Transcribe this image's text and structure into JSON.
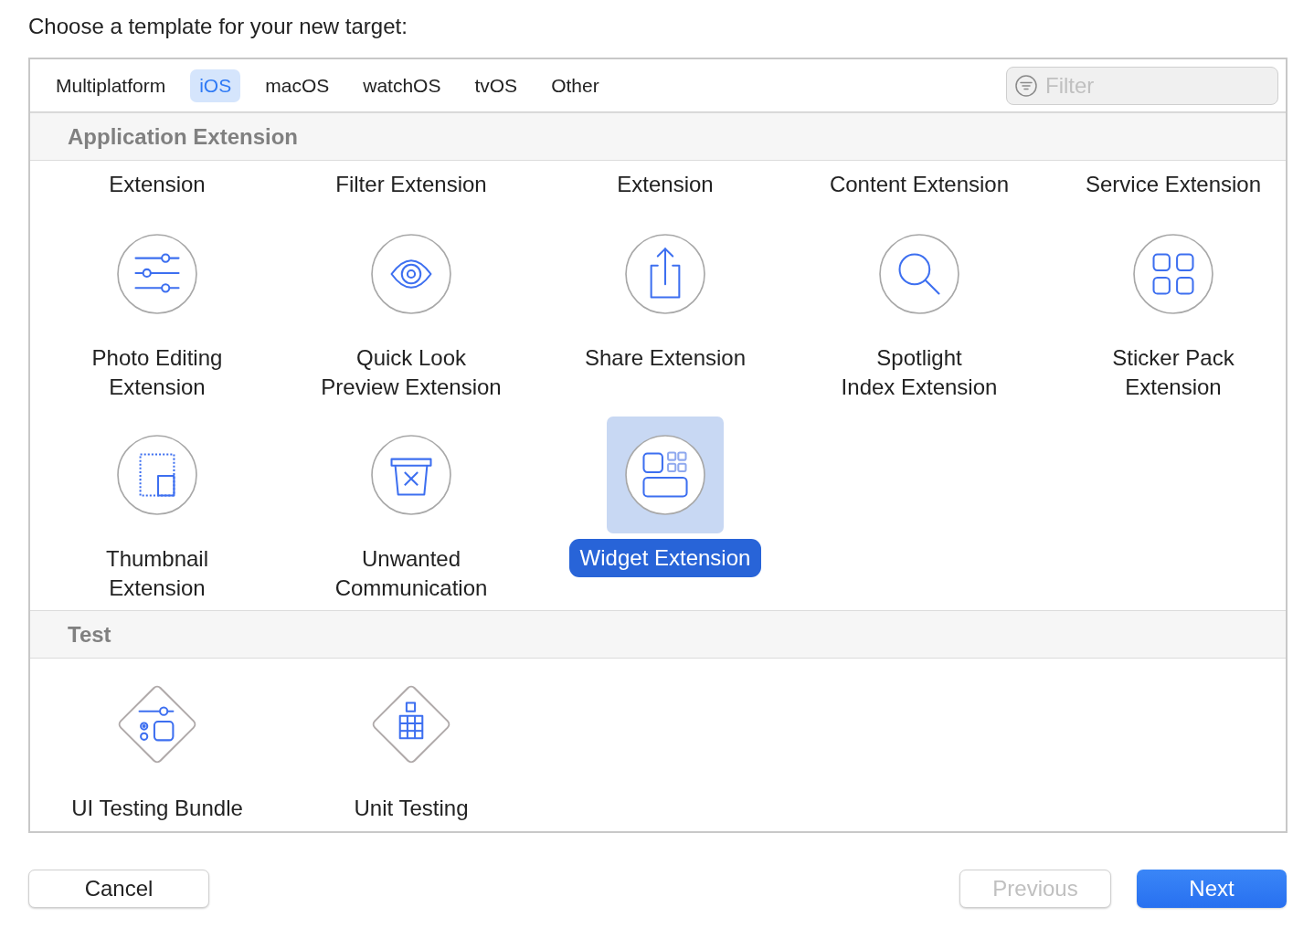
{
  "prompt": "Choose a template for your new target:",
  "tabs": [
    {
      "label": "Multiplatform",
      "selected": false
    },
    {
      "label": "iOS",
      "selected": true
    },
    {
      "label": "macOS",
      "selected": false
    },
    {
      "label": "watchOS",
      "selected": false
    },
    {
      "label": "tvOS",
      "selected": false
    },
    {
      "label": "Other",
      "selected": false
    }
  ],
  "filter": {
    "placeholder": "Filter"
  },
  "sections": [
    {
      "title": "Application Extension",
      "partial_labels": [
        "Extension",
        "Filter Extension",
        "Extension",
        "Content Extension",
        "Service Extension"
      ],
      "templates": [
        {
          "label": "Photo Editing\nExtension",
          "kind": "sliders",
          "selected": false
        },
        {
          "label": "Quick Look\nPreview Extension",
          "kind": "eye",
          "selected": false
        },
        {
          "label": "Share Extension",
          "kind": "share",
          "selected": false
        },
        {
          "label": "Spotlight\nIndex Extension",
          "kind": "search",
          "selected": false
        },
        {
          "label": "Sticker Pack\nExtension",
          "kind": "grid",
          "selected": false
        },
        {
          "label": "Thumbnail\nExtension",
          "kind": "thumbnail",
          "selected": false
        },
        {
          "label": "Unwanted\nCommunication",
          "kind": "trash",
          "selected": false
        },
        {
          "label": "Widget Extension",
          "kind": "widget",
          "selected": true
        }
      ]
    },
    {
      "title": "Test",
      "templates": [
        {
          "label": "UI Testing Bundle",
          "kind": "uitest",
          "selected": false
        },
        {
          "label": "Unit Testing",
          "kind": "unittest",
          "selected": false
        }
      ]
    }
  ],
  "buttons": [
    {
      "label": "Cancel",
      "kind": "normal",
      "disabled": false
    },
    {
      "label": "Previous",
      "kind": "normal",
      "disabled": true
    },
    {
      "label": "Next",
      "kind": "primary",
      "disabled": false
    }
  ]
}
